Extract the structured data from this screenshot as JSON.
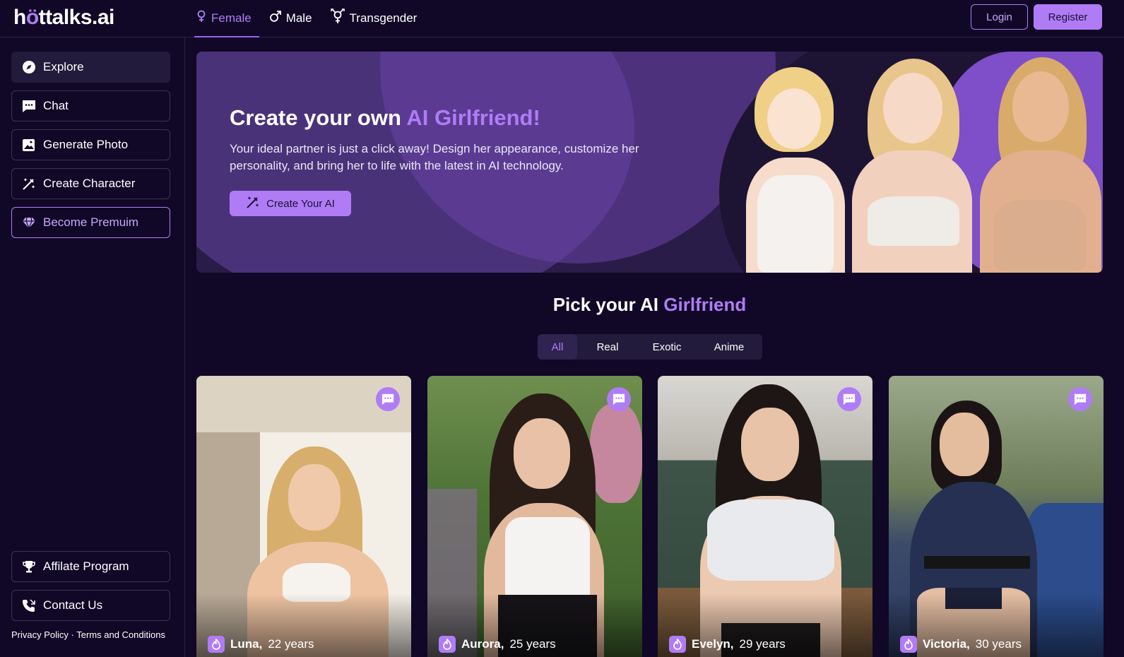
{
  "brand": {
    "logo_pre": "h",
    "logo_drop": "ö",
    "logo_post": "ttalks.ai"
  },
  "gender_tabs": [
    {
      "label": "Female",
      "icon": "female-icon",
      "active": true
    },
    {
      "label": "Male",
      "icon": "male-icon",
      "active": false
    },
    {
      "label": "Transgender",
      "icon": "transgender-icon",
      "active": false
    }
  ],
  "auth": {
    "login": "Login",
    "register": "Register"
  },
  "sidebar": {
    "items": [
      {
        "label": "Explore",
        "icon": "compass-icon",
        "active": true
      },
      {
        "label": "Chat",
        "icon": "chat-icon"
      },
      {
        "label": "Generate Photo",
        "icon": "image-icon"
      },
      {
        "label": "Create Character",
        "icon": "magic-wand-icon"
      },
      {
        "label": "Become Premuim",
        "icon": "diamond-icon"
      }
    ],
    "bottom_items": [
      {
        "label": "Affilate Program",
        "icon": "trophy-icon"
      },
      {
        "label": "Contact Us",
        "icon": "phone-icon"
      }
    ],
    "legal": {
      "privacy": "Privacy Policy",
      "separator": " · ",
      "terms": "Terms and Conditions"
    }
  },
  "hero": {
    "title_pre": "Create your own ",
    "title_accent": "AI Girlfriend!",
    "description": "Your ideal partner is just a click away! Design her appearance, customize her personality, and bring her to life with the latest in AI technology.",
    "button": "Create Your AI"
  },
  "pick": {
    "title_pre": "Pick your AI ",
    "title_accent": "Girlfriend",
    "filters": [
      "All",
      "Real",
      "Exotic",
      "Anime"
    ],
    "active_filter": "All"
  },
  "cards": [
    {
      "name": "Luna,",
      "age": "22 years"
    },
    {
      "name": "Aurora,",
      "age": "25 years"
    },
    {
      "name": "Evelyn,",
      "age": "29 years"
    },
    {
      "name": "Victoria,",
      "age": "30 years"
    }
  ],
  "colors": {
    "accent": "#b07cf5",
    "background": "#100826",
    "panel": "#231b3b"
  }
}
